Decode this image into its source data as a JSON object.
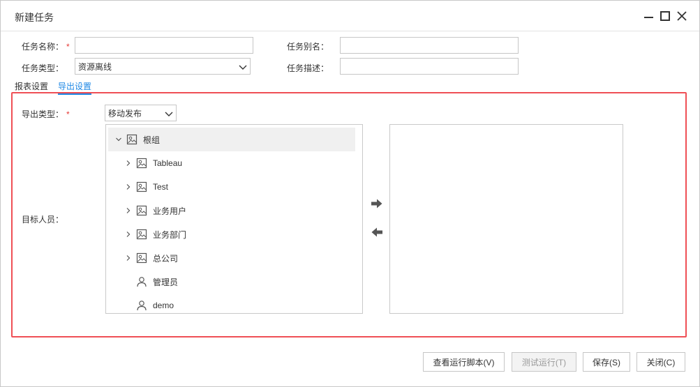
{
  "window": {
    "title": "新建任务",
    "controls": [
      "minimize-icon",
      "maximize-icon",
      "close-icon"
    ]
  },
  "form": {
    "task_name_label": "任务名称：",
    "task_name_required": "*",
    "task_name_value": "",
    "task_alias_label": "任务别名：",
    "task_alias_value": "",
    "task_type_label": "任务类型：",
    "task_type_value": "资源离线",
    "task_desc_label": "任务描述：",
    "task_desc_value": ""
  },
  "tabs": [
    {
      "label": "报表设置",
      "active": false
    },
    {
      "label": "导出设置",
      "active": true
    }
  ],
  "export": {
    "export_type_label": "导出类型：",
    "export_type_required": "*",
    "export_type_value": "移动发布",
    "target_label": "目标人员：",
    "tree": [
      {
        "label": "根组",
        "expanded": true,
        "icon": "group-icon",
        "level": 0
      },
      {
        "label": "Tableau",
        "expanded": false,
        "icon": "group-icon",
        "level": 1
      },
      {
        "label": "Test",
        "expanded": false,
        "icon": "group-icon",
        "level": 1
      },
      {
        "label": "业务用户",
        "expanded": false,
        "icon": "group-icon",
        "level": 1
      },
      {
        "label": "业务部门",
        "expanded": false,
        "icon": "group-icon",
        "level": 1
      },
      {
        "label": "总公司",
        "expanded": false,
        "icon": "group-icon",
        "level": 1
      },
      {
        "label": "管理员",
        "icon": "user-icon",
        "level": 1
      },
      {
        "label": "demo",
        "icon": "user-icon",
        "level": 1
      }
    ],
    "move_right_icon": "arrow-right-icon",
    "move_left_icon": "arrow-left-icon"
  },
  "footer": {
    "view_script": "查看运行脚本(V)",
    "test_run": "测试运行(T)",
    "save": "保存(S)",
    "close": "关闭(C)"
  },
  "colors": {
    "accent": "#1f88e5",
    "required": "#e53935",
    "highlight_border": "#ef4f55"
  }
}
